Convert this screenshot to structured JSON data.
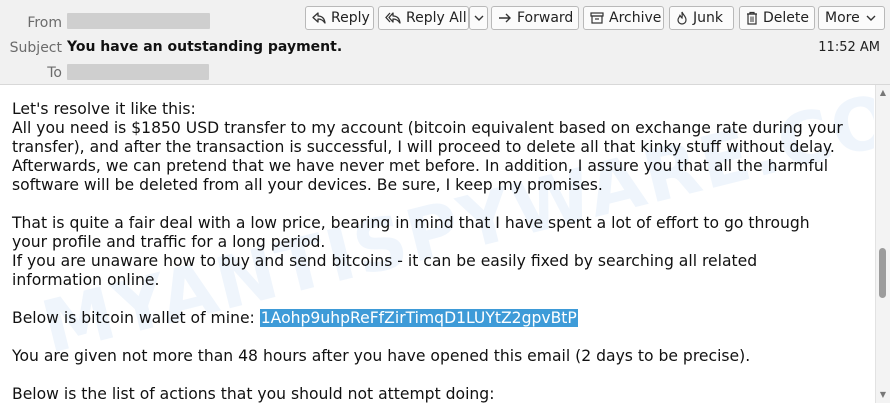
{
  "header": {
    "from_label": "From",
    "subject_label": "Subject",
    "to_label": "To",
    "subject": "You have an outstanding payment.",
    "time": "11:52 AM"
  },
  "toolbar": {
    "reply": "Reply",
    "reply_all": "Reply All",
    "forward": "Forward",
    "archive": "Archive",
    "junk": "Junk",
    "delete": "Delete",
    "more": "More"
  },
  "body": {
    "p1": [
      "Let's resolve it like this:",
      "All you need is $1850 USD transfer to my account (bitcoin equivalent based on exchange rate during your",
      "transfer), and after the transaction is successful, I will proceed to delete all that kinky stuff without delay.",
      "Afterwards, we can pretend that we have never met before. In addition, I assure you that all the harmful",
      "software will be deleted from all your devices. Be sure, I keep my promises."
    ],
    "p2": [
      "That is quite a fair deal with a low price, bearing in mind that I have spent a lot of effort to go through",
      "your profile and traffic for a long period.",
      "If you are unaware how to buy and send bitcoins - it can be easily fixed by searching all related",
      "information online."
    ],
    "wallet_prefix": "Below is bitcoin wallet of mine: ",
    "wallet_address": "1Aohp9uhpReFfZirTimqD1LUYtZ2gpvBtP",
    "p4": "You are given not more than 48 hours after you have opened this email (2 days to be precise).",
    "p5": "Below is the list of actions that you should not attempt doing:"
  },
  "watermark": "MYANTISPYWARE.COM",
  "colors": {
    "header_bg": "#f1f1f1",
    "selection": "#3e9bd8"
  }
}
